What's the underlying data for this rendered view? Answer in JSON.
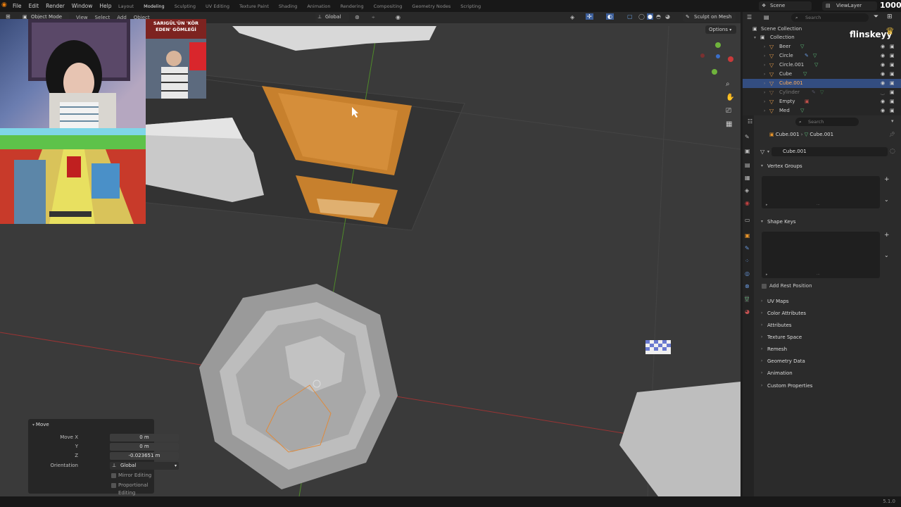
{
  "topbar": {
    "menu": [
      "File",
      "Edit",
      "Render",
      "Window",
      "Help"
    ],
    "workspaces": [
      "Layout",
      "Modeling",
      "Sculpting",
      "UV Editing",
      "Texture Paint",
      "Shading",
      "Animation",
      "Rendering",
      "Compositing",
      "Geometry Nodes",
      "Scripting"
    ],
    "active_workspace": "Modeling",
    "scene": "Scene",
    "view_layer": "ViewLayer",
    "count_overlay": "1000"
  },
  "viewport": {
    "mode": "Object Mode",
    "menu": [
      "View",
      "Select",
      "Add",
      "Object"
    ],
    "orientation": "Global",
    "sculpt_button": "Sculpt on Mesh",
    "options_button": "Options"
  },
  "overlay": {
    "news_title": "SARIGÜL'ÜN 'KÖR EDEN' GÖMLEĞİ",
    "watermark": "flinskeyy"
  },
  "move_panel": {
    "title": "Move",
    "move_x_label": "Move X",
    "move_x": "0 m",
    "y_label": "Y",
    "y": "0 m",
    "z_label": "Z",
    "z": "-0.023651 m",
    "orientation_label": "Orientation",
    "orientation": "Global",
    "mirror_label": "Mirror Editing",
    "proportional_label": "Proportional Editing"
  },
  "outliner": {
    "search_placeholder": "Search",
    "scene_collection": "Scene Collection",
    "collection": "Collection",
    "items": [
      "Beer",
      "Circle",
      "Circle.001",
      "Cube",
      "Cube.001",
      "Cylinder",
      "Empty",
      "Med"
    ],
    "selected_item": "Cube.001"
  },
  "properties": {
    "search_placeholder": "Search",
    "breadcrumb_object": "Cube.001",
    "breadcrumb_mesh": "Cube.001",
    "mesh_name": "Cube.001",
    "sections": {
      "vertex_groups": "Vertex Groups",
      "shape_keys": "Shape Keys",
      "add_rest_position": "Add Rest Position",
      "uv_maps": "UV Maps",
      "color_attributes": "Color Attributes",
      "attributes": "Attributes",
      "texture_space": "Texture Space",
      "remesh": "Remesh",
      "geometry_data": "Geometry Data",
      "animation": "Animation",
      "custom_properties": "Custom Properties"
    }
  },
  "status": {
    "version": "5.1.0"
  },
  "colors": {
    "accent_selection": "#334d80",
    "object_orange": "#e29a4a",
    "mesh_green": "#5fc47c",
    "x_axis": "#c83a3a",
    "y_axis": "#6fb33c"
  }
}
